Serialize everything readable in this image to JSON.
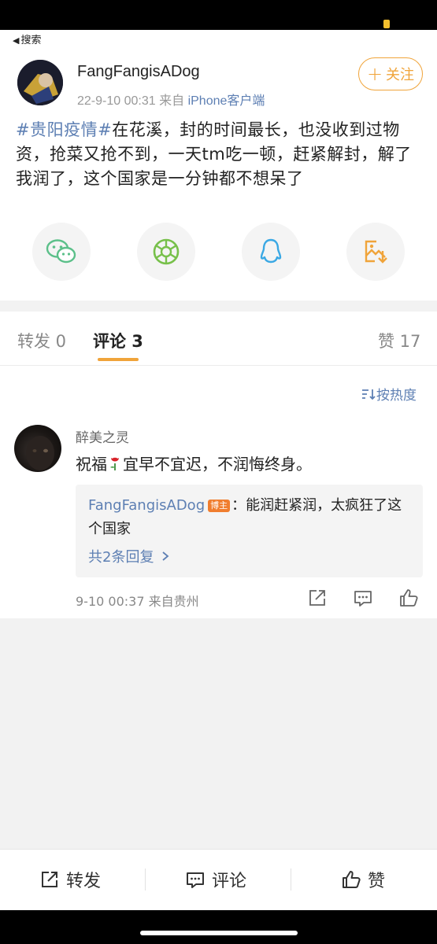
{
  "nav": {
    "back_label": "搜索"
  },
  "post": {
    "username": "FangFangisADog",
    "date": "22-9-10 00:31",
    "source_prefix": "来自",
    "source": "iPhone客户端",
    "follow_label": "关注",
    "topic": "#贵阳疫情#",
    "body": "在花溪，封的时间最长，也没收到过物资，抢菜又抢不到，一天tm吃一顿，赶紧解封，解了我润了，这个国家是一分钟都不想呆了"
  },
  "share": {
    "icons": [
      "wechat-icon",
      "moments-icon",
      "qq-icon",
      "save-image-icon"
    ]
  },
  "tabs": {
    "repost": "转发 0",
    "comments": "评论 3",
    "likes": "赞 17"
  },
  "sort": {
    "label": "按热度"
  },
  "comment": {
    "author": "醉美之灵",
    "text_before": "祝福",
    "text_after": "宜早不宜迟，不润悔终身。",
    "reply": {
      "author": "FangFangisADog",
      "badge": "博主",
      "text": "：能润赶紧润，太疯狂了这个国家"
    },
    "more_replies": "共2条回复",
    "time": "9-10 00:37",
    "location": "来自贵州"
  },
  "bottom_bar": {
    "repost": "转发",
    "comment": "评论",
    "like": "赞"
  },
  "colors": {
    "accent": "#f0a43a",
    "link": "#5d7fb3",
    "badge": "#f07d2e"
  }
}
